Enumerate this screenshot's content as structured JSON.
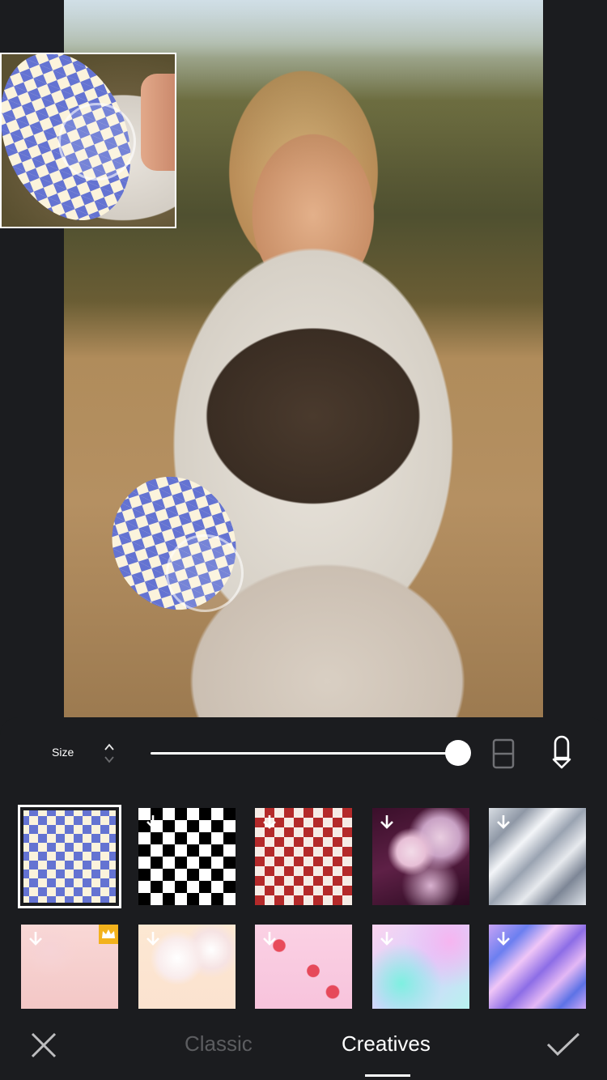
{
  "toolbar": {
    "size_label": "Size",
    "size_value": 1.0
  },
  "tabs": [
    {
      "label": "Classic",
      "active": false
    },
    {
      "label": "Creatives",
      "active": true
    }
  ],
  "patterns": [
    {
      "name": "blue-wavy-checker",
      "selected": true,
      "download": false,
      "premium": false
    },
    {
      "name": "black-white-checker",
      "selected": false,
      "download": true,
      "premium": false
    },
    {
      "name": "red-white-checker",
      "selected": false,
      "download": true,
      "premium": false
    },
    {
      "name": "pink-clouds",
      "selected": false,
      "download": true,
      "premium": false
    },
    {
      "name": "silver-holographic",
      "selected": false,
      "download": true,
      "premium": false
    },
    {
      "name": "pink-popsicle",
      "selected": false,
      "download": true,
      "premium": true
    },
    {
      "name": "yogurt-bottles",
      "selected": false,
      "download": true,
      "premium": false
    },
    {
      "name": "strawberry-love",
      "selected": false,
      "download": true,
      "premium": false
    },
    {
      "name": "pastel-gradient",
      "selected": false,
      "download": true,
      "premium": false
    },
    {
      "name": "purple-holographic",
      "selected": false,
      "download": true,
      "premium": false
    }
  ],
  "icons": {
    "close": "close-icon",
    "confirm": "check-icon",
    "eraser": "eraser-icon",
    "brush": "brush-icon",
    "download": "download-icon",
    "premium": "crown-icon"
  },
  "colors": {
    "background": "#1b1c1f",
    "active_tab": "#ffffff",
    "inactive_tab": "#5c5d60",
    "checker_blue": "#6473d2",
    "checker_cream": "#fbf3dc",
    "premium_gold": "#f3b21c"
  }
}
